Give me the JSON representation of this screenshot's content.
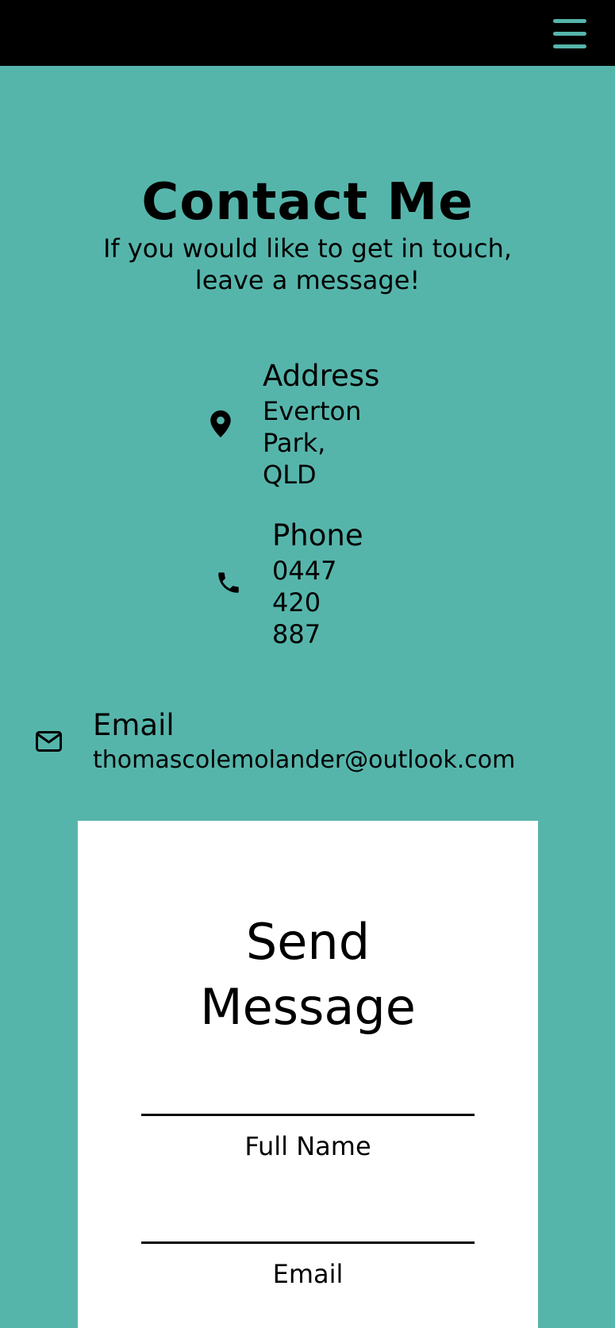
{
  "header": {
    "menu_icon": "hamburger-menu-icon",
    "menu_color": "#56b5ab",
    "background": "#000000"
  },
  "page": {
    "background": "#56b5ab",
    "title": "Contact Me",
    "subtitle": "If you would like to get in touch, leave a message!"
  },
  "contact": {
    "address": {
      "icon": "map-pin-icon",
      "label": "Address",
      "line1": "Everton",
      "line2": "Park,",
      "line3": "QLD"
    },
    "phone": {
      "icon": "phone-icon",
      "label": "Phone",
      "line1": "0447",
      "line2": "420",
      "line3": "887"
    },
    "email": {
      "icon": "envelope-icon",
      "label": "Email",
      "value": "thomascolemolander@outlook.com"
    }
  },
  "form": {
    "title_line1": "Send",
    "title_line2": "Message",
    "fields": [
      {
        "label": "Full Name",
        "value": ""
      },
      {
        "label": "Email",
        "value": ""
      }
    ]
  }
}
